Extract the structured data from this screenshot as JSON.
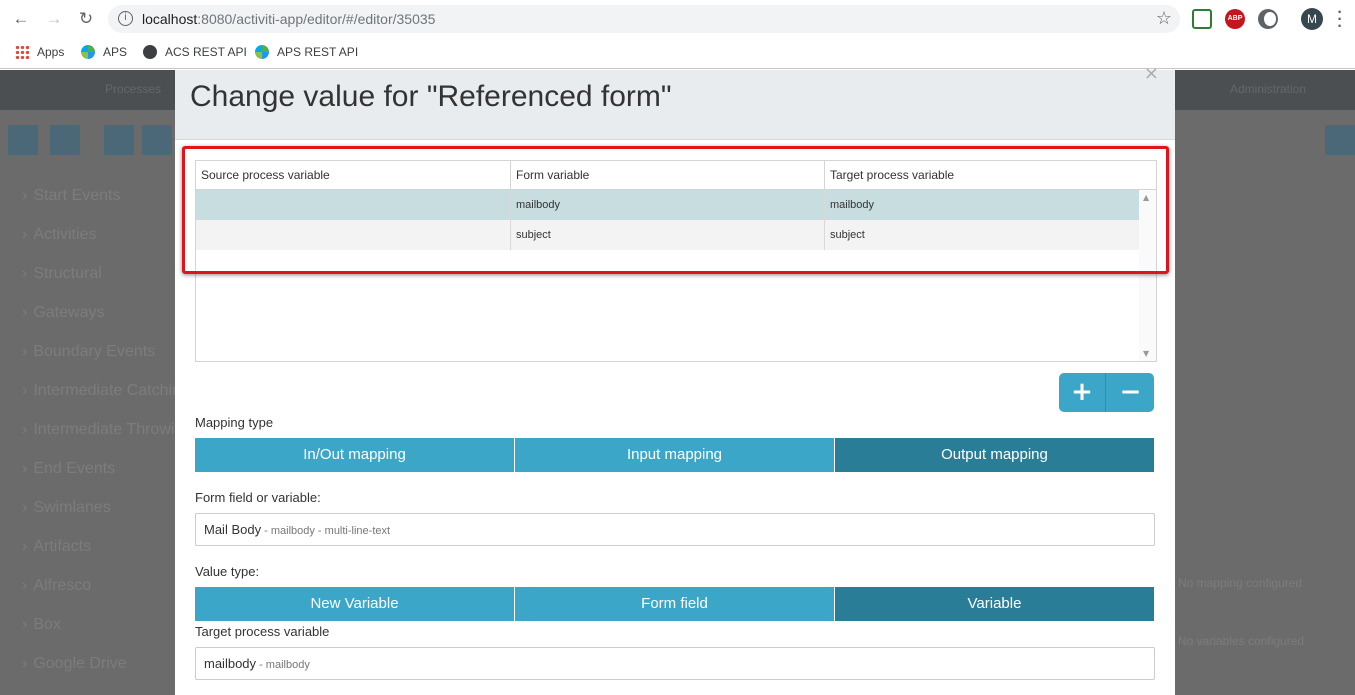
{
  "browser": {
    "url_host": "localhost",
    "url_rest": ":8080/activiti-app/editor/#/editor/35035",
    "avatar_letter": "M",
    "abp_label": "ABP",
    "bookmarks": [
      {
        "label": "Apps",
        "icon": "apps-grid-icon"
      },
      {
        "label": "APS",
        "icon": "aps-icon"
      },
      {
        "label": "ACS REST API",
        "icon": "globe-icon"
      },
      {
        "label": "APS REST API",
        "icon": "aps-icon"
      }
    ]
  },
  "background": {
    "topbar_left": "Processes",
    "topbar_right": "Administration",
    "palette": [
      "Start Events",
      "Activities",
      "Structural",
      "Gateways",
      "Boundary Events",
      "Intermediate Catching Events",
      "Intermediate Throwing Events",
      "End Events",
      "Swimlanes",
      "Artifacts",
      "Alfresco",
      "Box",
      "Google Drive"
    ],
    "right_notes": [
      "No mapping configured",
      "No variables configured"
    ]
  },
  "modal": {
    "title": "Change value for \"Referenced form\"",
    "close_label": "×",
    "grid": {
      "columns": [
        "Source process variable",
        "Form variable",
        "Target process variable"
      ],
      "rows": [
        {
          "source": "",
          "form": "mailbody",
          "target": "mailbody"
        },
        {
          "source": "",
          "form": "subject",
          "target": "subject"
        }
      ]
    },
    "add_label": "+",
    "remove_label": "−",
    "mapping_type_label": "Mapping type",
    "mapping_types": [
      "In/Out mapping",
      "Input mapping",
      "Output mapping"
    ],
    "mapping_active": "Output mapping",
    "form_field_label": "Form field or variable:",
    "form_field_value": "Mail Body",
    "form_field_sub": " - mailbody - multi-line-text",
    "value_type_label": "Value type:",
    "value_types": [
      "New Variable",
      "Form field",
      "Variable"
    ],
    "value_type_active": "Variable",
    "target_label": "Target process variable",
    "target_value": "mailbody",
    "target_sub": " - mailbody"
  },
  "colors": {
    "accent": "#3ba6c7",
    "accent_active": "#2a7d96",
    "highlight_border": "#e2141b",
    "selected_row": "#c8dde0"
  }
}
